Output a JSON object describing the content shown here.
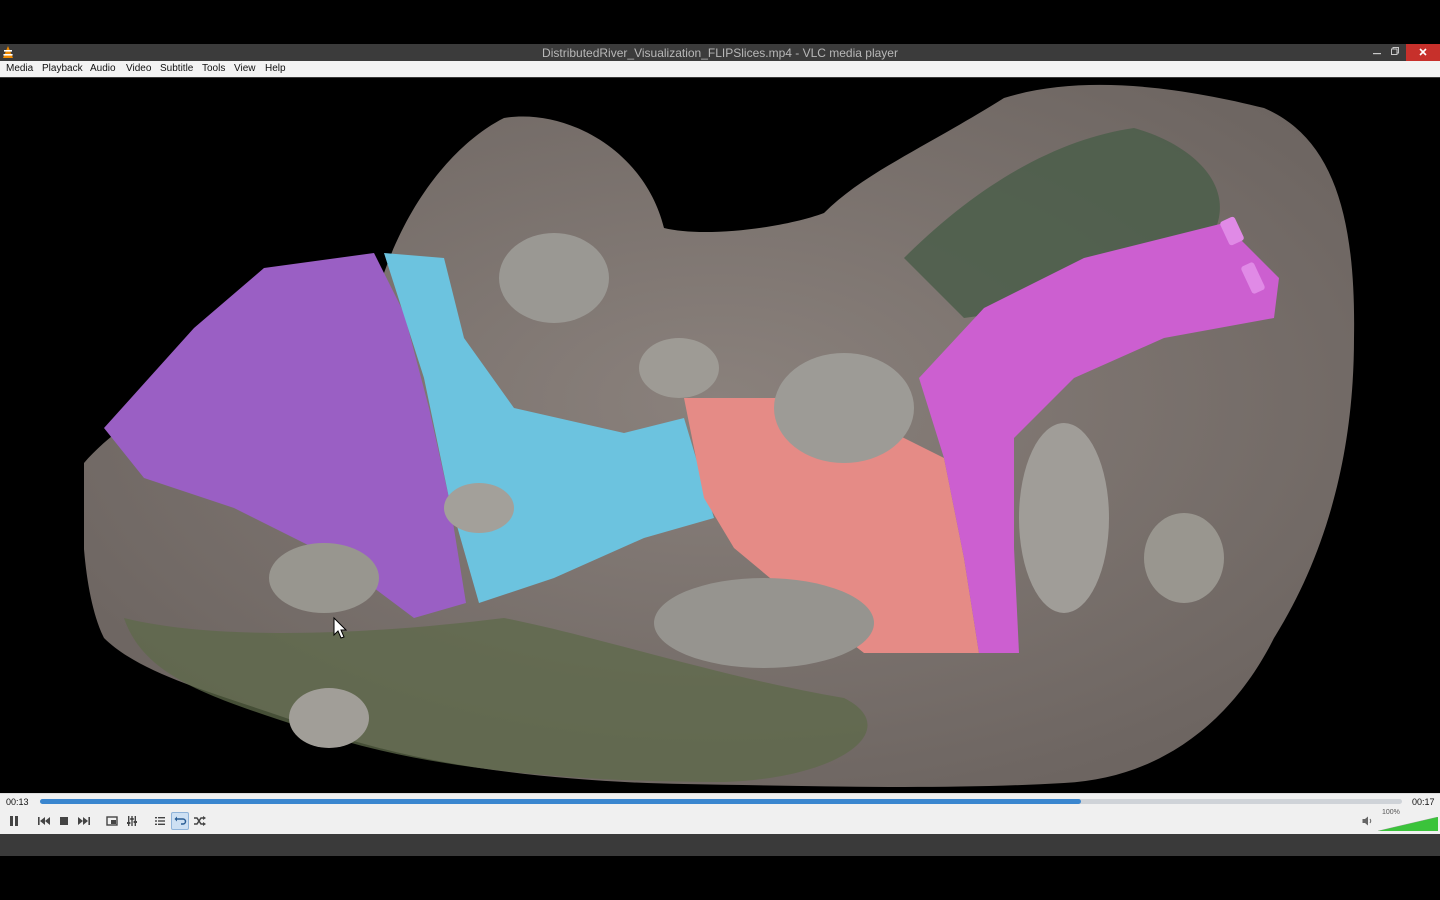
{
  "window": {
    "title": "DistributedRiver_Visualization_FLIPSlices.mp4 - VLC media player",
    "minimize_icon": "minimize-icon",
    "maximize_icon": "restore-icon",
    "close_icon": "close-icon"
  },
  "menubar": {
    "items": [
      "Media",
      "Playback",
      "Audio",
      "Video",
      "Subtitle",
      "Tools",
      "View",
      "Help"
    ]
  },
  "playback": {
    "elapsed": "00:13",
    "total": "00:17",
    "progress": 0.7645
  },
  "volume": {
    "percent_label": "100%",
    "level": 1.0
  },
  "controls": {
    "buttons": [
      "pause-icon",
      "previous-icon",
      "stop-icon",
      "next-icon",
      "fullscreen-icon",
      "extended-settings-icon",
      "playlist-icon",
      "loop-icon",
      "shuffle-icon",
      "speaker-icon"
    ]
  },
  "colors": {
    "seek_fill": "#3a86cf",
    "close_button": "#c7302b",
    "water_purple": "#9a5fc4",
    "water_cyan": "#6cc3df",
    "water_salmon": "#e58b86",
    "water_magenta": "#cc5fd0",
    "terrain": "#7d7571",
    "volume_green": "#3bc33b"
  }
}
